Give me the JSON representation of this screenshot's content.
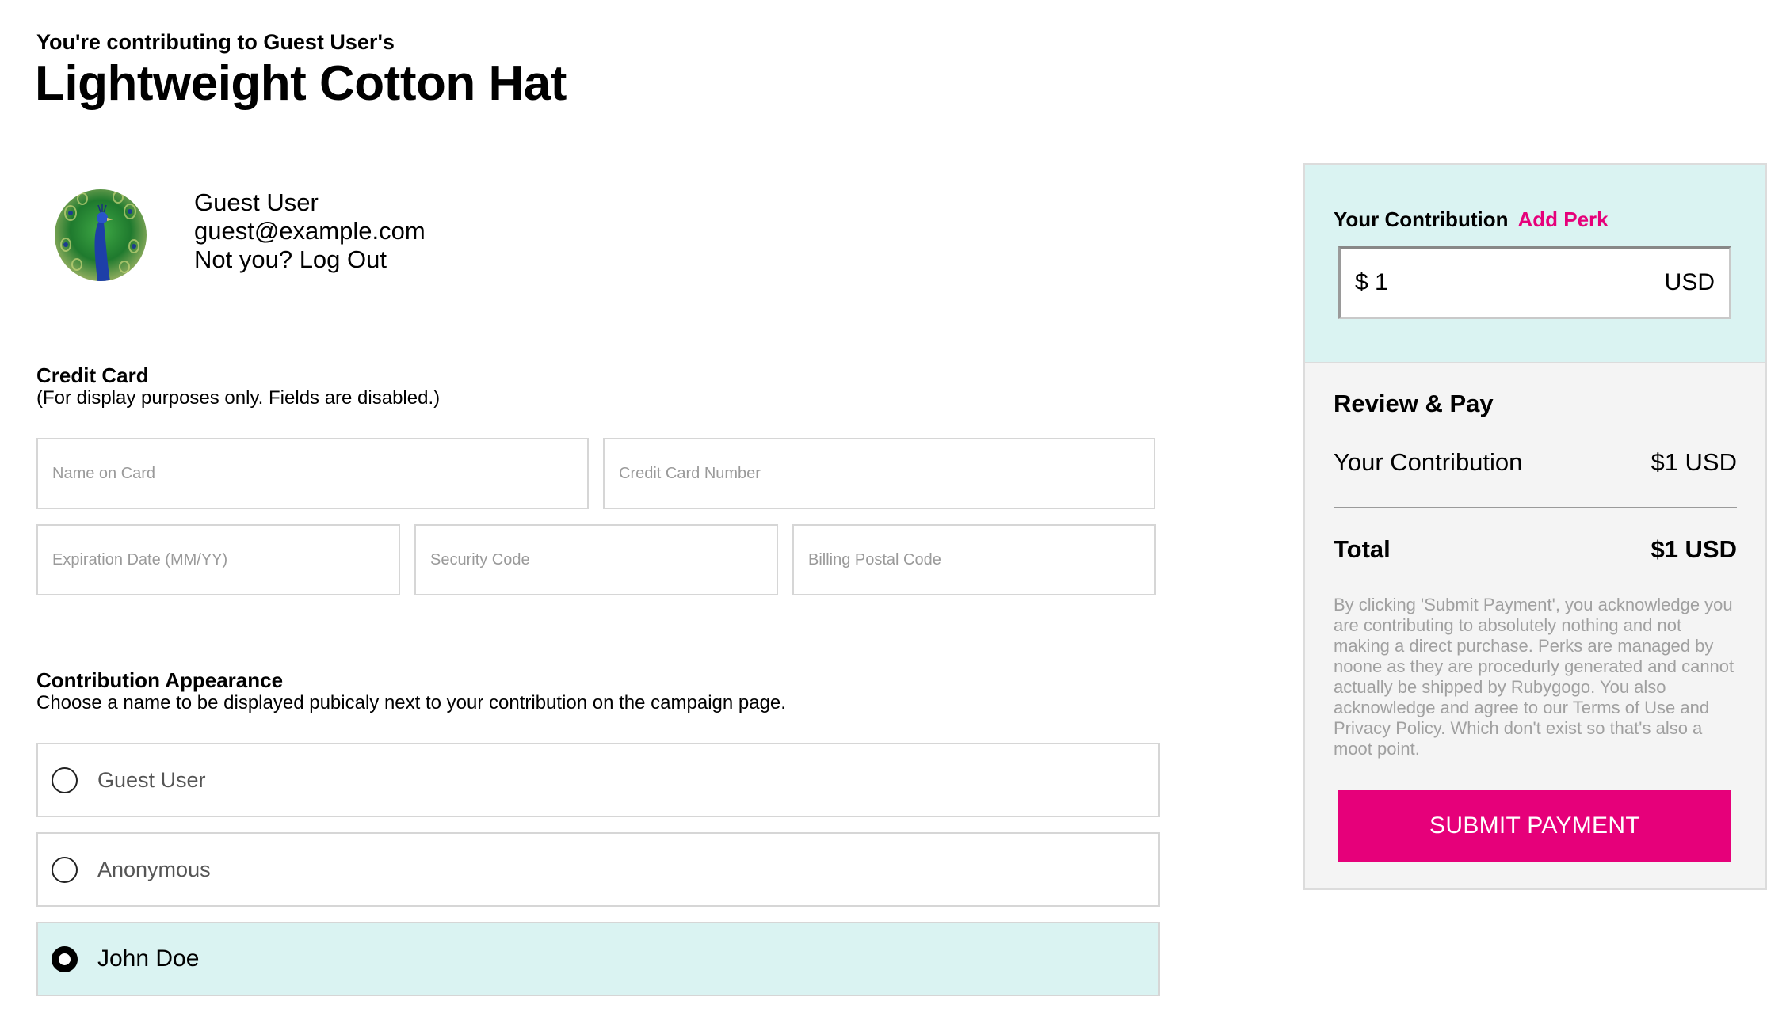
{
  "header": {
    "pretitle": "You're contributing to Guest User's",
    "title": "Lightweight Cotton Hat"
  },
  "user": {
    "name": "Guest User",
    "email": "guest@example.com",
    "logout": "Not you? Log Out",
    "avatar_icon": "peacock-avatar"
  },
  "credit_card": {
    "heading": "Credit Card",
    "subheading": "(For display purposes only. Fields are disabled.)",
    "name_placeholder": "Name on Card",
    "number_placeholder": "Credit Card Number",
    "expiration_placeholder": "Expiration Date (MM/YY)",
    "security_placeholder": "Security Code",
    "postal_placeholder": "Billing Postal Code"
  },
  "appearance": {
    "heading": "Contribution Appearance",
    "subheading": "Choose a name to be displayed pubicaly next to your contribution on the campaign page.",
    "options": [
      {
        "label": "Guest User",
        "selected": false
      },
      {
        "label": "Anonymous",
        "selected": false
      },
      {
        "label": "John Doe",
        "selected": true
      }
    ]
  },
  "sidebar": {
    "contribution_label": "Your Contribution",
    "add_perk": "Add Perk",
    "amount": "$ 1",
    "currency": "USD",
    "review_title": "Review & Pay",
    "contribution_row_label": "Your Contribution",
    "contribution_row_value": "$1 USD",
    "total_label": "Total",
    "total_value": "$1 USD",
    "disclaimer": "By clicking 'Submit Payment', you acknowledge you are contributing to absolutely nothing and not making a direct purchase. Perks are managed by noone as they are procedurly generated and cannot actually be shipped by Rubygogo. You also acknowledge and agree to our Terms of Use and Privacy Policy. Which don't exist so that's also a moot point.",
    "submit": "SUBMIT PAYMENT"
  },
  "colors": {
    "accent": "#e6007a",
    "selected_bg": "#daf3f2",
    "panel_bg": "#f4f4f4"
  }
}
